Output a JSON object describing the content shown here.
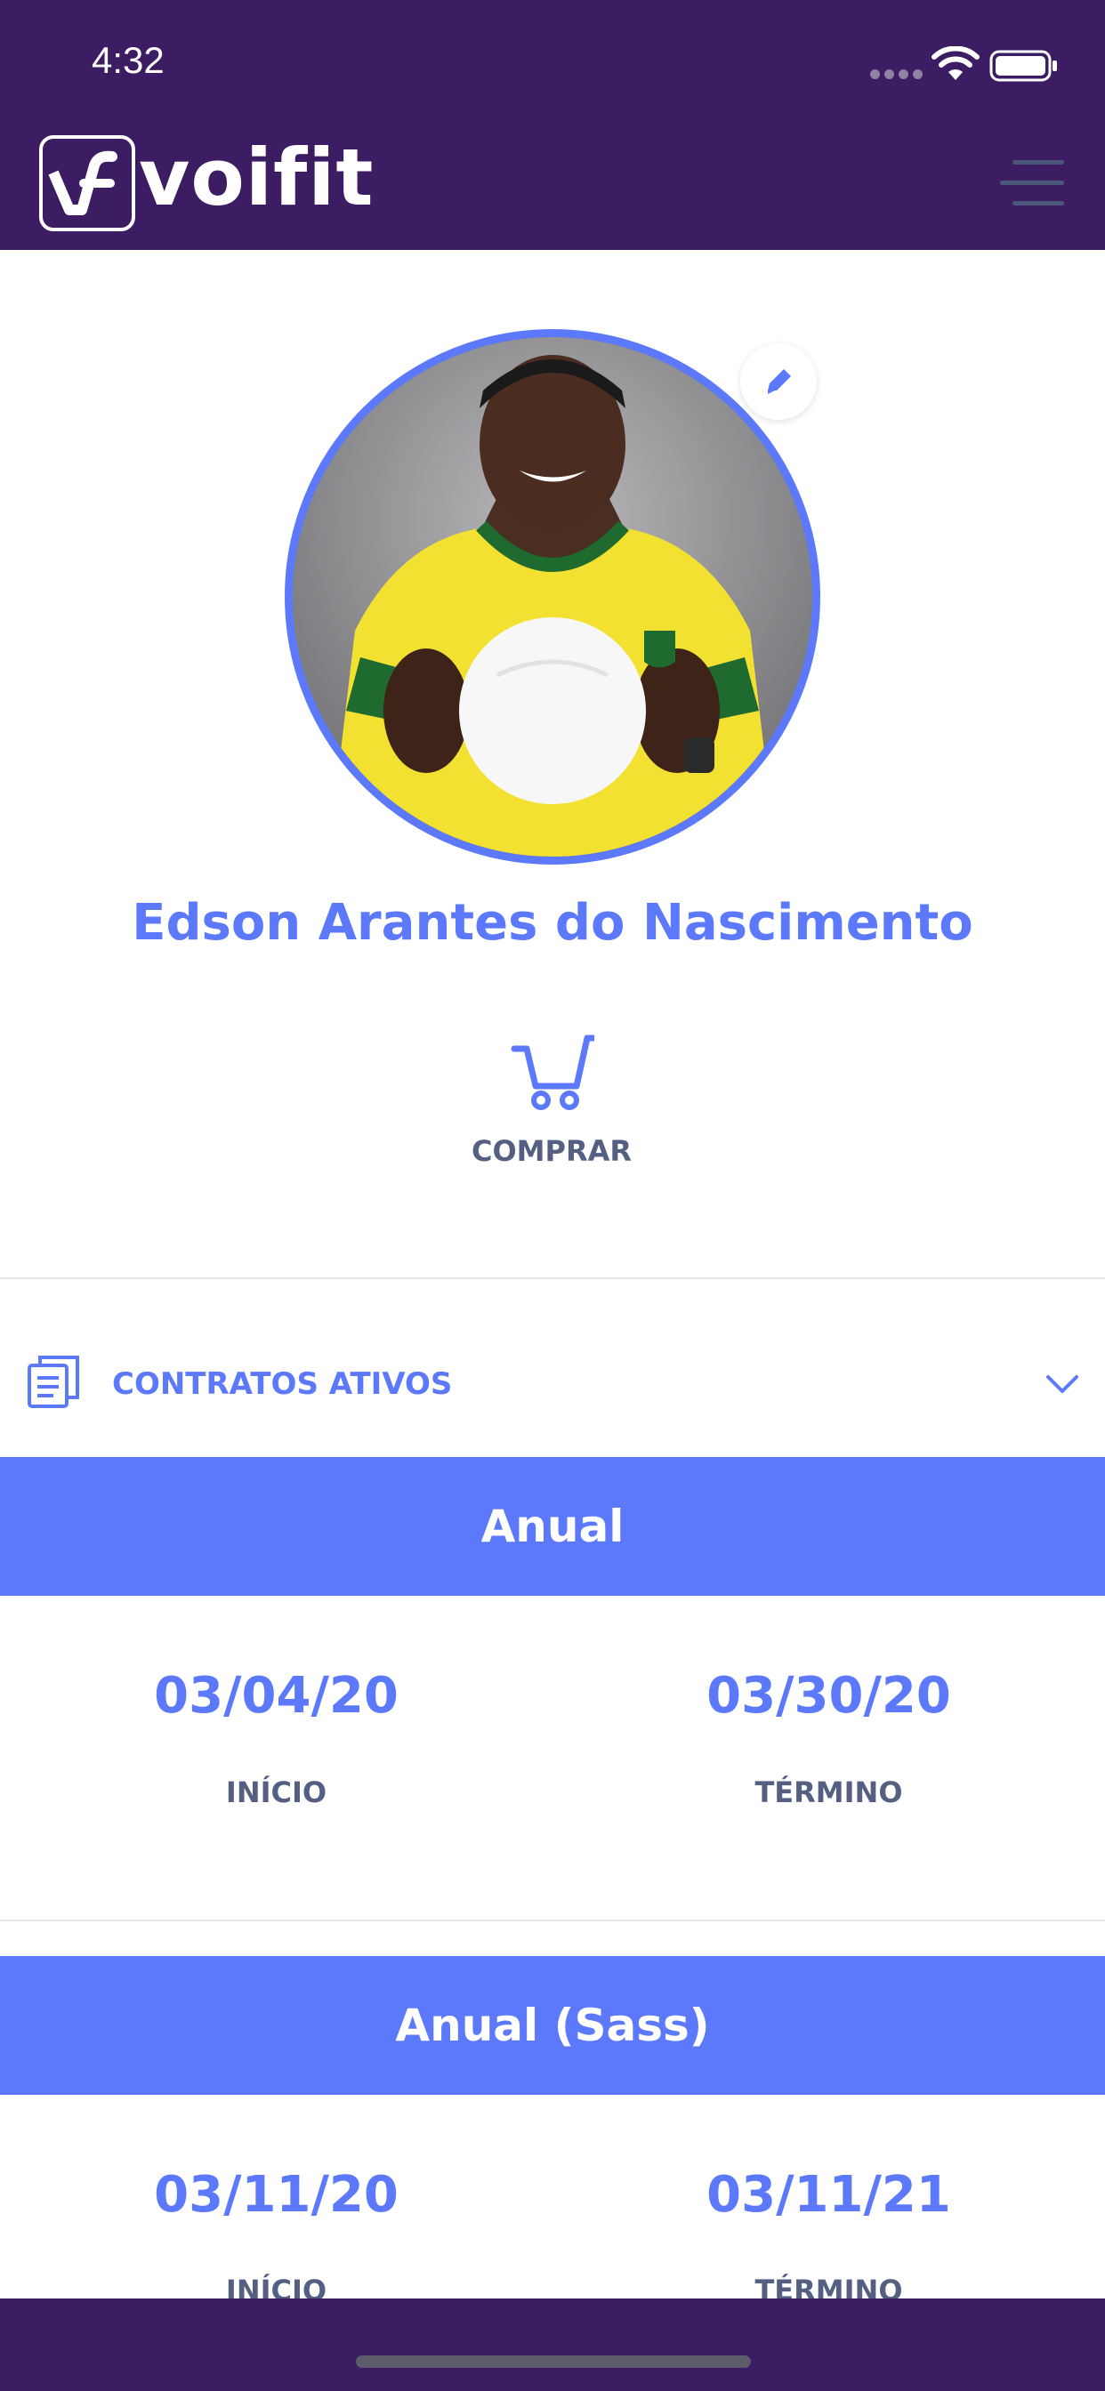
{
  "status_bar": {
    "time": "4:32"
  },
  "header": {
    "logo_text": "voifit",
    "background_color": "#3c1c62"
  },
  "profile": {
    "name": "Edson Arantes do Nascimento"
  },
  "actions": {
    "buy_label": "COMPRAR"
  },
  "contracts": {
    "section_label": "CONTRATOS ATIVOS",
    "items": [
      {
        "plan": "Anual",
        "start_date": "03/04/20",
        "start_label": "INÍCIO",
        "end_date": "03/30/20",
        "end_label": "TÉRMINO"
      },
      {
        "plan": "Anual (Sass)",
        "start_date": "03/11/20",
        "start_label": "INÍCIO",
        "end_date": "03/11/21",
        "end_label": "TÉRMINO"
      }
    ]
  },
  "colors": {
    "accent": "#5d79fb",
    "label": "#555f82",
    "brand_dark": "#3c1c62"
  },
  "icons": [
    "wifi-icon",
    "battery-icon",
    "menu-icon",
    "pencil-icon",
    "cart-icon",
    "document-icon",
    "chevron-down-icon"
  ]
}
